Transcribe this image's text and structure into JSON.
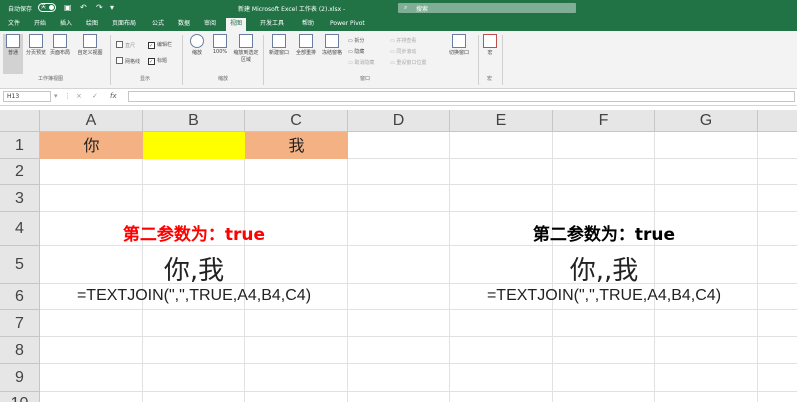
{
  "title_bar": {
    "autosave_label": "自动保存",
    "autosave_state": "关",
    "save_icon": "save-icon",
    "undo_icon": "undo-icon",
    "redo_icon": "redo-icon",
    "doc_title": "新建 Microsoft Excel 工作表 (2).xlsx  -",
    "search_placeholder": "搜索",
    "accent_color": "#217346"
  },
  "tabs": [
    "文件",
    "开始",
    "插入",
    "绘图",
    "页面布局",
    "公式",
    "数据",
    "审阅",
    "视图",
    "开发工具",
    "帮助",
    "Power Pivot"
  ],
  "active_tab_index": 8,
  "ribbon": {
    "workbook_views": {
      "buttons": [
        "普通",
        "分页预览",
        "页面布局",
        "自定义视图"
      ],
      "label": "工作簿视图"
    },
    "show": {
      "items": [
        "直尺",
        "编辑栏",
        "网格线",
        "标题"
      ],
      "label": "显示"
    },
    "zoom": {
      "buttons": [
        "缩放",
        "100%",
        "缩放到选定区域"
      ],
      "label": "缩放"
    },
    "window": {
      "buttons": [
        "新建窗口",
        "全部重排",
        "冻结窗格"
      ],
      "small": [
        "拆分",
        "隐藏",
        "取消隐藏",
        "并排查看",
        "同步滚动",
        "重设窗口位置"
      ],
      "switch_label": "切换窗口",
      "label": "窗口"
    },
    "macro": {
      "button": "宏",
      "label": "宏"
    }
  },
  "formula_bar": {
    "name_box": "H13",
    "cancel_icon": "×",
    "enter_icon": "✓",
    "fx_label": "fx",
    "formula": ""
  },
  "grid": {
    "columns": [
      "A",
      "B",
      "C",
      "D",
      "E",
      "F",
      "G"
    ],
    "rows": [
      "1",
      "2",
      "3",
      "4",
      "5",
      "6",
      "7",
      "8",
      "9",
      "10"
    ],
    "cells": {
      "A1": "你",
      "B1": "",
      "C1": "我"
    },
    "fill_colors": {
      "A1": "#f4b183",
      "B1": "#ffff00",
      "C1": "#f4b183"
    },
    "left_example": {
      "heading": "第二参数为：true",
      "heading_color": "#ff0000",
      "result": "你,我",
      "formula": "=TEXTJOIN(\",\",TRUE,A4,B4,C4)"
    },
    "right_example": {
      "heading": "第二参数为：true",
      "heading_color": "#000000",
      "result": "你,,我",
      "formula": "=TEXTJOIN(\",\",TRUE,A4,B4,C4)"
    }
  }
}
